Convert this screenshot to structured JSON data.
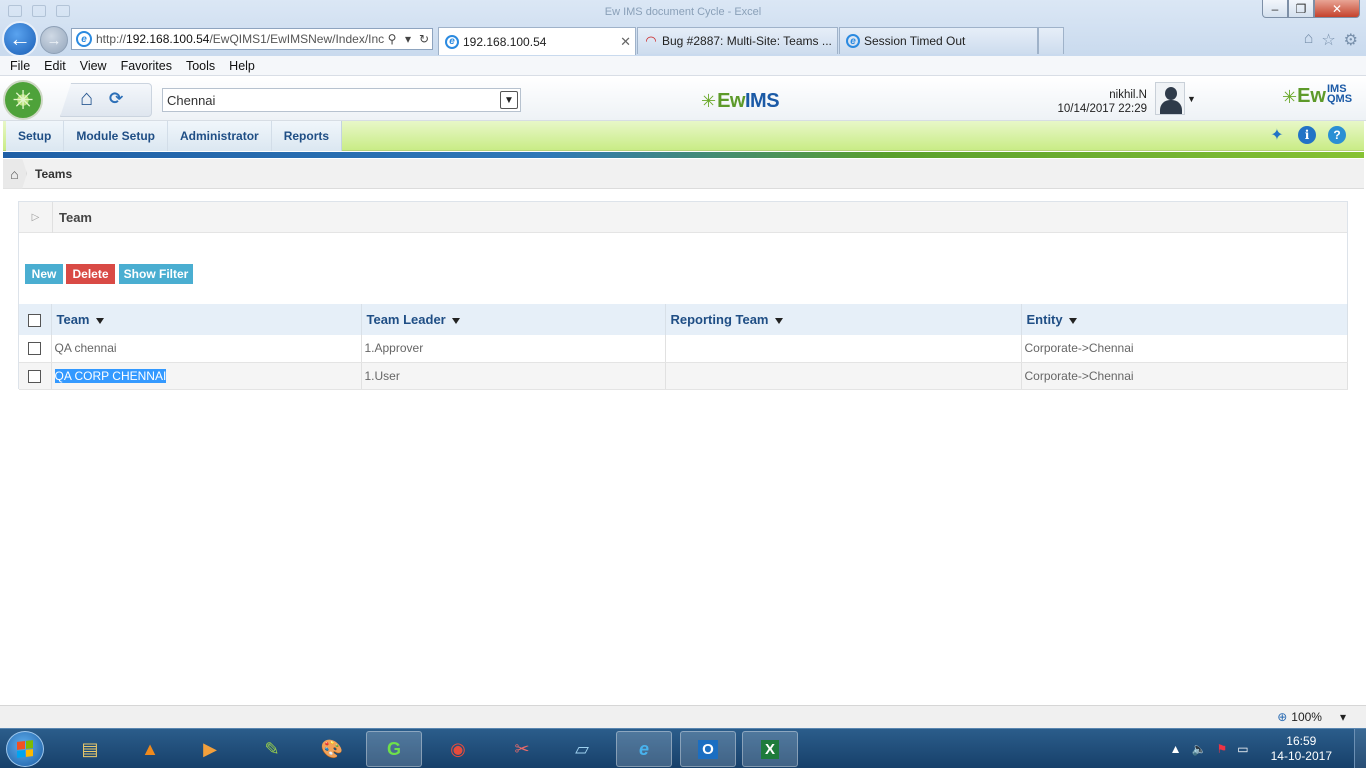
{
  "browser": {
    "window_title": "Ew IMS document Cycle - Excel",
    "address_url_prefix": "http://",
    "address_url_host": "192.168.100.54",
    "address_url_path": "/EwQIMS1/EwIMSNew/Index/Inc",
    "tabs": [
      {
        "label": "192.168.100.54",
        "active": true,
        "icon": "ie-icon"
      },
      {
        "label": "Bug #2887: Multi-Site: Teams ...",
        "active": false,
        "icon": "redmine-icon"
      },
      {
        "label": "Session Timed Out",
        "active": false,
        "icon": "ie-icon"
      }
    ],
    "menu": [
      "File",
      "Edit",
      "View",
      "Favorites",
      "Tools",
      "Help"
    ],
    "zoom": "100%"
  },
  "app": {
    "site_selected": "Chennai",
    "logo_center_ew": "Ew",
    "logo_center_ims": "IMS",
    "logo_right_ew": "Ew",
    "logo_right_ims": "IMS",
    "logo_right_qms": "QMS",
    "user_name": "nikhil.N",
    "user_datetime": "10/14/2017 22:29",
    "nav": [
      "Setup",
      "Module Setup",
      "Administrator",
      "Reports"
    ],
    "breadcrumb": "Teams",
    "panel_title": "Team",
    "buttons": {
      "new": "New",
      "delete": "Delete",
      "filter": "Show Filter"
    },
    "grid": {
      "columns": [
        "Team",
        "Team Leader",
        "Reporting Team",
        "Entity"
      ],
      "rows": [
        {
          "team": "QA chennai",
          "leader": "1.Approver",
          "reporting": "",
          "entity": "Corporate->Chennai"
        },
        {
          "team": "QA CORP CHENNAI",
          "leader": "1.User",
          "reporting": "",
          "entity": "Corporate->Chennai"
        }
      ]
    }
  },
  "taskbar": {
    "time": "16:59",
    "date": "14-10-2017"
  },
  "colors": {
    "accent_blue": "#1f4e85",
    "nav_green": "#c9ec86",
    "btn_info": "#4aaed1",
    "btn_danger": "#d94a45"
  }
}
